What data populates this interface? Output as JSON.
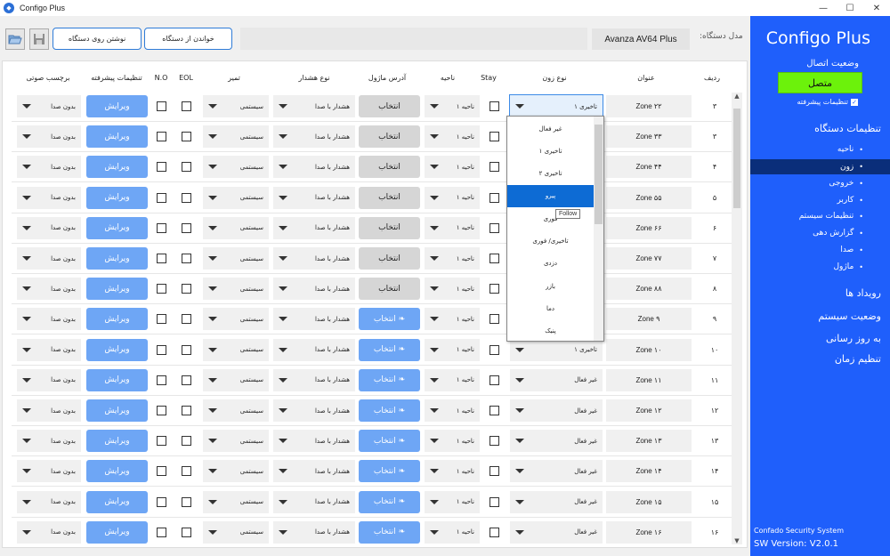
{
  "window": {
    "title": "Configo Plus",
    "minimize": "—",
    "maximize": "☐",
    "close": "✕"
  },
  "toolbar": {
    "read_label": "خواندن از دستگاه",
    "write_label": "نوشتن روی دستگاه",
    "device_model_label": "مدل دستگاه:",
    "device_model_value": "Avanza AV64 Plus"
  },
  "sidebar": {
    "title": "Configo Plus",
    "connection_label": "وضعیت اتصال",
    "connection_status": "متصل",
    "advanced_label": "تنظیمات پیشرفته",
    "device_settings": "تنظیمات دستگاه",
    "sub_items": [
      "ناحیه",
      "زون",
      "خروجی",
      "کاربر",
      "تنظیمات سیستم",
      "گزارش دهی",
      "صدا",
      "ماژول"
    ],
    "sections": [
      "رویداد ها",
      "وضعیت سیستم",
      "به روز رسانی",
      "تنظیم زمان"
    ],
    "footer_company": "Confado Security System",
    "footer_version": "SW Version: V2.0.1"
  },
  "table": {
    "headers": {
      "row": "ردیف",
      "title": "عنوان",
      "zone_type": "نوع زون",
      "stay": "Stay",
      "area": "ناحیه",
      "module_address": "آدرس ماژول",
      "alarm_type": "نوع هشدار",
      "delay": "تمیر",
      "eol": "EOL",
      "no": "N.O",
      "advanced": "تنظیمات پیشرفته",
      "voice_tag": "برچسب صوتی"
    },
    "rows": [
      {
        "num": "۳",
        "title": "Zone ۲۲",
        "zone_type": "تاخیری ۱",
        "area": "ناحیه ۱",
        "module": "انتخاب",
        "module_active": false,
        "alarm": "هشدار با صدا",
        "delay": "سیستمی",
        "edit": "ویرایش",
        "voice": "بدون صدا"
      },
      {
        "num": "۳",
        "title": "Zone ۳۳",
        "zone_type": "",
        "area": "ناحیه ۱",
        "module": "انتخاب",
        "module_active": false,
        "alarm": "هشدار با صدا",
        "delay": "سیستمی",
        "edit": "ویرایش",
        "voice": "بدون صدا"
      },
      {
        "num": "۴",
        "title": "Zone ۴۴",
        "zone_type": "",
        "area": "ناحیه ۱",
        "module": "انتخاب",
        "module_active": false,
        "alarm": "هشدار با صدا",
        "delay": "سیستمی",
        "edit": "ویرایش",
        "voice": "بدون صدا"
      },
      {
        "num": "۵",
        "title": "Zone ۵۵",
        "zone_type": "",
        "area": "ناحیه ۱",
        "module": "انتخاب",
        "module_active": false,
        "alarm": "هشدار با صدا",
        "delay": "سیستمی",
        "edit": "ویرایش",
        "voice": "بدون صدا"
      },
      {
        "num": "۶",
        "title": "Zone ۶۶",
        "zone_type": "",
        "area": "ناحیه ۱",
        "module": "انتخاب",
        "module_active": false,
        "alarm": "هشدار با صدا",
        "delay": "سیستمی",
        "edit": "ویرایش",
        "voice": "بدون صدا"
      },
      {
        "num": "۷",
        "title": "Zone ۷۷",
        "zone_type": "",
        "area": "ناحیه ۱",
        "module": "انتخاب",
        "module_active": false,
        "alarm": "هشدار با صدا",
        "delay": "سیستمی",
        "edit": "ویرایش",
        "voice": "بدون صدا"
      },
      {
        "num": "۸",
        "title": "Zone ۸۸",
        "zone_type": "",
        "area": "ناحیه ۱",
        "module": "انتخاب",
        "module_active": false,
        "alarm": "هشدار با صدا",
        "delay": "سیستمی",
        "edit": "ویرایش",
        "voice": "بدون صدا"
      },
      {
        "num": "۹",
        "title": "Zone ۹",
        "zone_type": "",
        "area": "ناحیه ۱",
        "module": "انتخاب",
        "module_active": true,
        "alarm": "هشدار با صدا",
        "delay": "سیستمی",
        "edit": "ویرایش",
        "voice": "بدون صدا"
      },
      {
        "num": "۱۰",
        "title": "Zone ۱۰",
        "zone_type": "تاخیری ۱",
        "area": "ناحیه ۱",
        "module": "انتخاب",
        "module_active": true,
        "alarm": "هشدار با صدا",
        "delay": "سیستمی",
        "edit": "ویرایش",
        "voice": "بدون صدا"
      },
      {
        "num": "۱۱",
        "title": "Zone ۱۱",
        "zone_type": "غیر فعال",
        "area": "ناحیه ۱",
        "module": "انتخاب",
        "module_active": true,
        "alarm": "هشدار با صدا",
        "delay": "سیستمی",
        "edit": "ویرایش",
        "voice": "بدون صدا"
      },
      {
        "num": "۱۲",
        "title": "Zone ۱۲",
        "zone_type": "غیر فعال",
        "area": "ناحیه ۱",
        "module": "انتخاب",
        "module_active": true,
        "alarm": "هشدار با صدا",
        "delay": "سیستمی",
        "edit": "ویرایش",
        "voice": "بدون صدا"
      },
      {
        "num": "۱۳",
        "title": "Zone ۱۳",
        "zone_type": "غیر فعال",
        "area": "ناحیه ۱",
        "module": "انتخاب",
        "module_active": true,
        "alarm": "هشدار با صدا",
        "delay": "سیستمی",
        "edit": "ویرایش",
        "voice": "بدون صدا"
      },
      {
        "num": "۱۴",
        "title": "Zone ۱۴",
        "zone_type": "غیر فعال",
        "area": "ناحیه ۱",
        "module": "انتخاب",
        "module_active": true,
        "alarm": "هشدار با صدا",
        "delay": "سیستمی",
        "edit": "ویرایش",
        "voice": "بدون صدا"
      },
      {
        "num": "۱۵",
        "title": "Zone ۱۵",
        "zone_type": "غیر فعال",
        "area": "ناحیه ۱",
        "module": "انتخاب",
        "module_active": true,
        "alarm": "هشدار با صدا",
        "delay": "سیستمی",
        "edit": "ویرایش",
        "voice": "بدون صدا"
      },
      {
        "num": "۱۶",
        "title": "Zone ۱۶",
        "zone_type": "غیر فعال",
        "area": "ناحیه ۱",
        "module": "انتخاب",
        "module_active": true,
        "alarm": "هشدار با صدا",
        "delay": "سیستمی",
        "edit": "ویرایش",
        "voice": "بدون صدا"
      }
    ]
  },
  "dropdown": {
    "options": [
      "غیر فعال",
      "تاخیری ۱",
      "تاخیری ۲",
      "پیرو",
      "فوری",
      "تاخیری/ فوری",
      "دزدی",
      "بازر",
      "دما",
      "پنیک"
    ],
    "selected": "پیرو",
    "tooltip": "Follow"
  },
  "colors": {
    "sidebar_bg": "#1f5ffb",
    "connected_green": "#6cf20b",
    "edit_button": "#6ea6f5",
    "dropdown_selected": "#0d6bd4"
  }
}
